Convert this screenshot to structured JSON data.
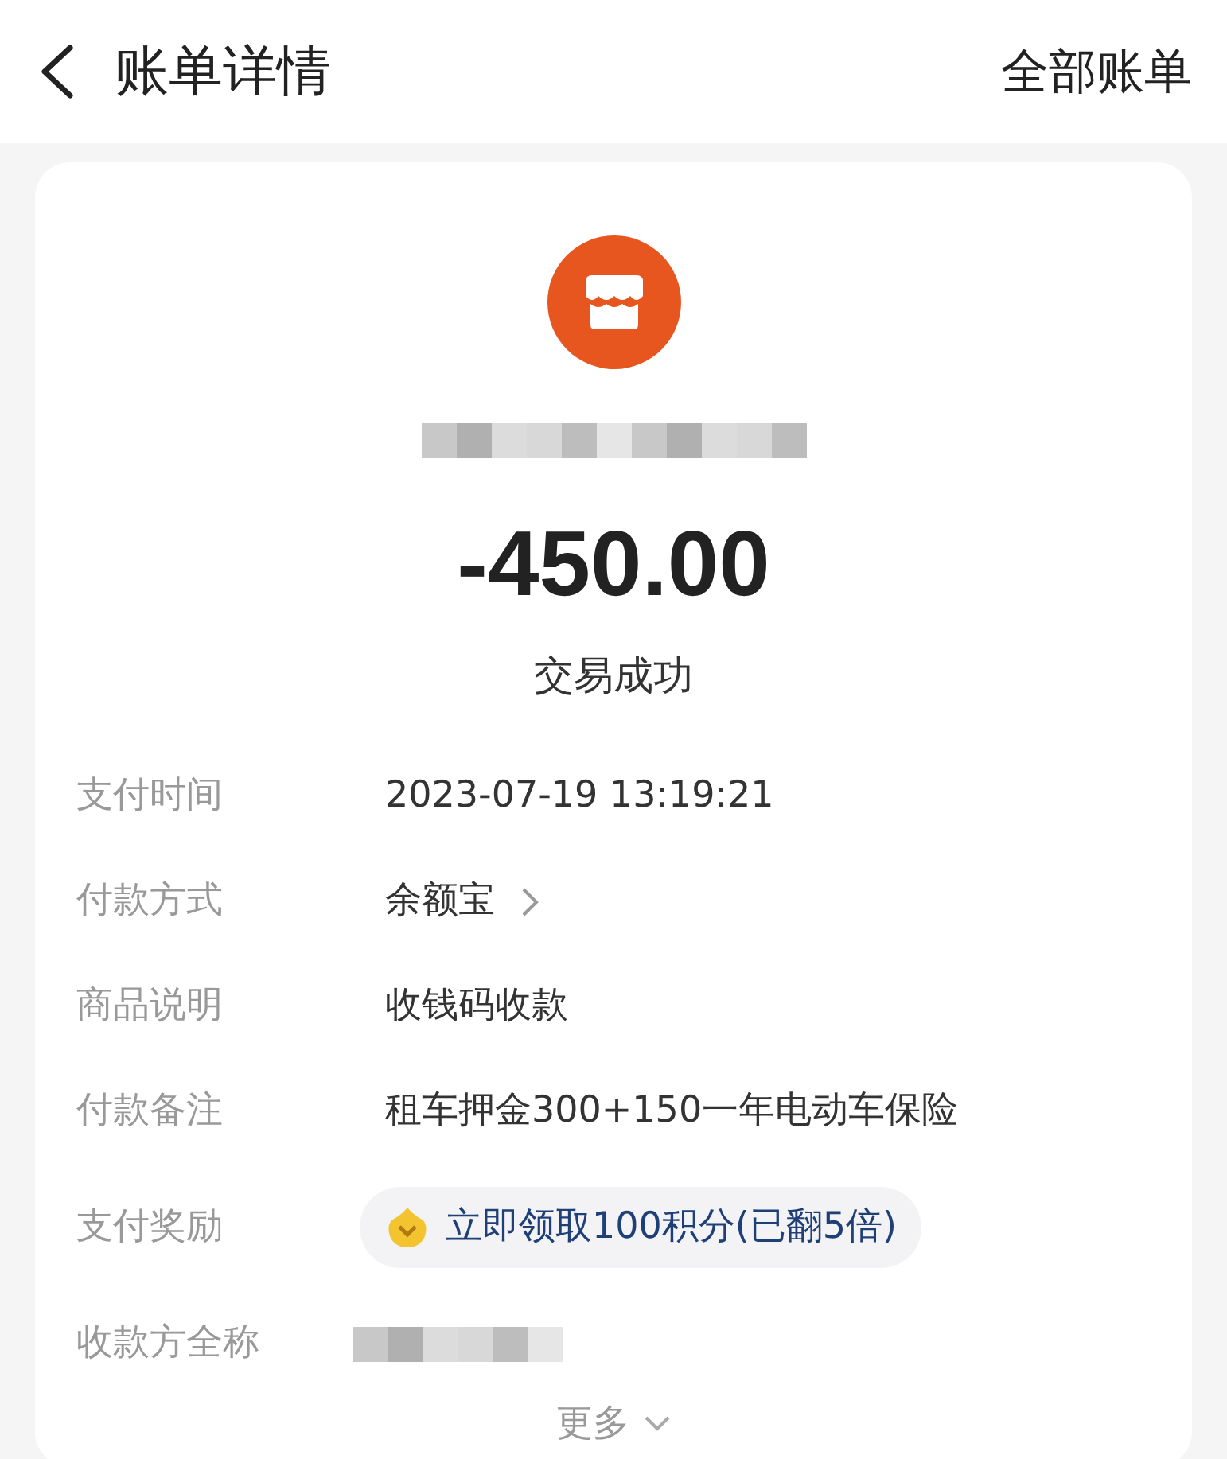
{
  "header": {
    "title": "账单详情",
    "action": "全部账单"
  },
  "summary": {
    "amount": "-450.00",
    "status": "交易成功"
  },
  "details": [
    {
      "label": "支付时间",
      "kind": "text",
      "value": "2023-07-19 13:19:21"
    },
    {
      "label": "付款方式",
      "kind": "link",
      "value": "余额宝"
    },
    {
      "label": "商品说明",
      "kind": "text",
      "value": "收钱码收款"
    },
    {
      "label": "付款备注",
      "kind": "text",
      "value": "租车押金300+150一年电动车保险"
    },
    {
      "label": "支付奖励",
      "kind": "reward",
      "value": "立即领取100积分(已翻5倍)"
    },
    {
      "label": "收款方全称",
      "kind": "redacted"
    }
  ],
  "more": "更多"
}
